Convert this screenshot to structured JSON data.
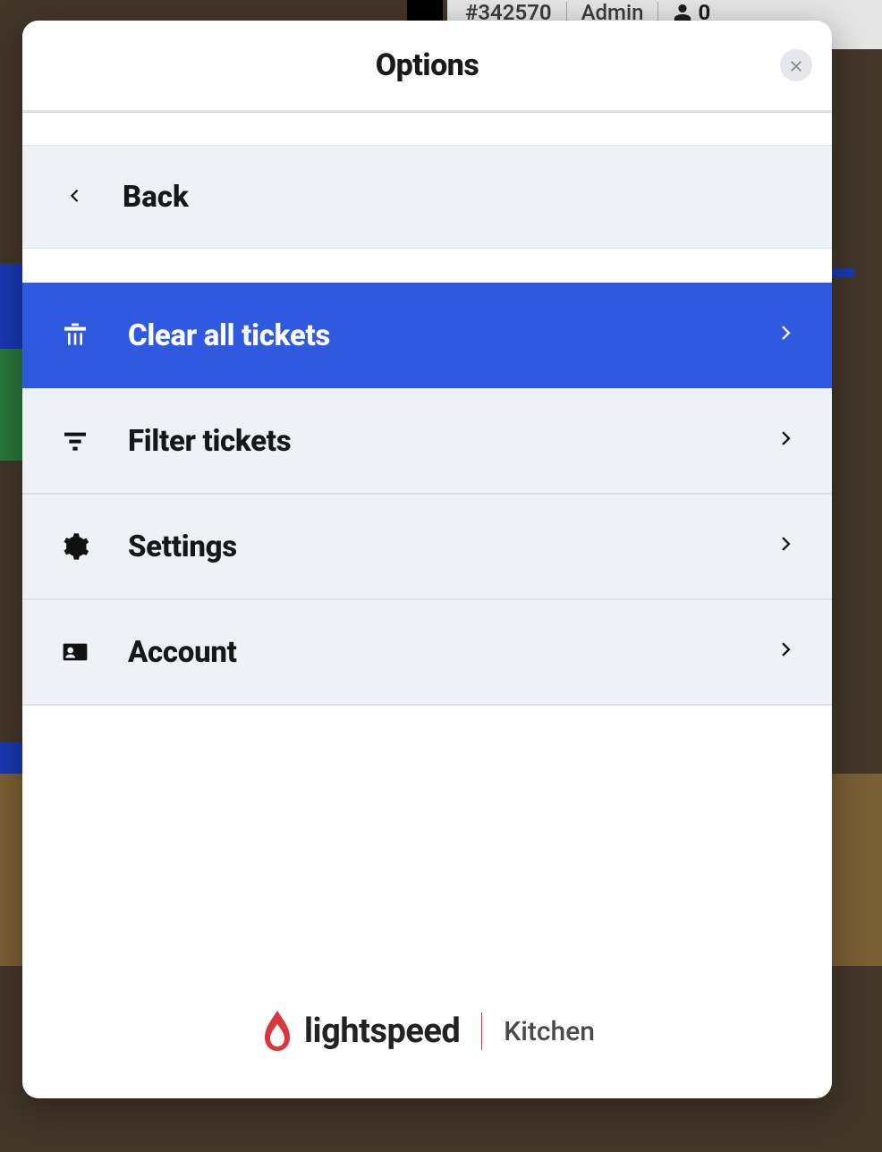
{
  "background": {
    "ticket_id": "#342570",
    "role": "Admin",
    "person_count": "0"
  },
  "modal": {
    "title": "Options",
    "back_label": "Back",
    "items": [
      {
        "label": "Clear all tickets",
        "selected": true,
        "icon": "trash"
      },
      {
        "label": "Filter tickets",
        "selected": false,
        "icon": "filter"
      },
      {
        "label": "Settings",
        "selected": false,
        "icon": "gear"
      },
      {
        "label": "Account",
        "selected": false,
        "icon": "id-card"
      }
    ],
    "brand": {
      "name": "lightspeed",
      "subname": "Kitchen"
    }
  }
}
